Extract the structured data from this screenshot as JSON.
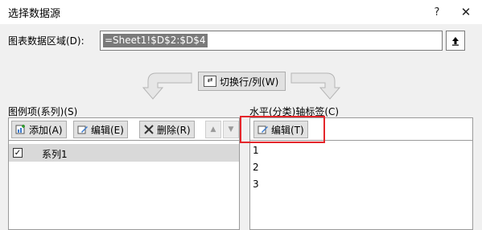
{
  "dialog": {
    "title": "选择数据源",
    "help_icon": "?",
    "close_icon": "✕"
  },
  "range": {
    "label": "图表数据区域(D):",
    "value": "=Sheet1!$D$2:$D$4"
  },
  "switch": {
    "label": "切换行/列(W)"
  },
  "legend": {
    "header": "图例项(系列)(S)",
    "add_label": "添加(A)",
    "edit_label": "编辑(E)",
    "delete_label": "删除(R)",
    "up_icon": "▲",
    "down_icon": "▼",
    "series": [
      {
        "name": "系列1",
        "checked": true
      }
    ]
  },
  "axis": {
    "header": "水平(分类)轴标签(C)",
    "edit_label": "编辑(T)",
    "items": [
      "1",
      "2",
      "3"
    ]
  },
  "colors": {
    "highlight": "#e4262b",
    "selection": "#7a7a7a"
  }
}
